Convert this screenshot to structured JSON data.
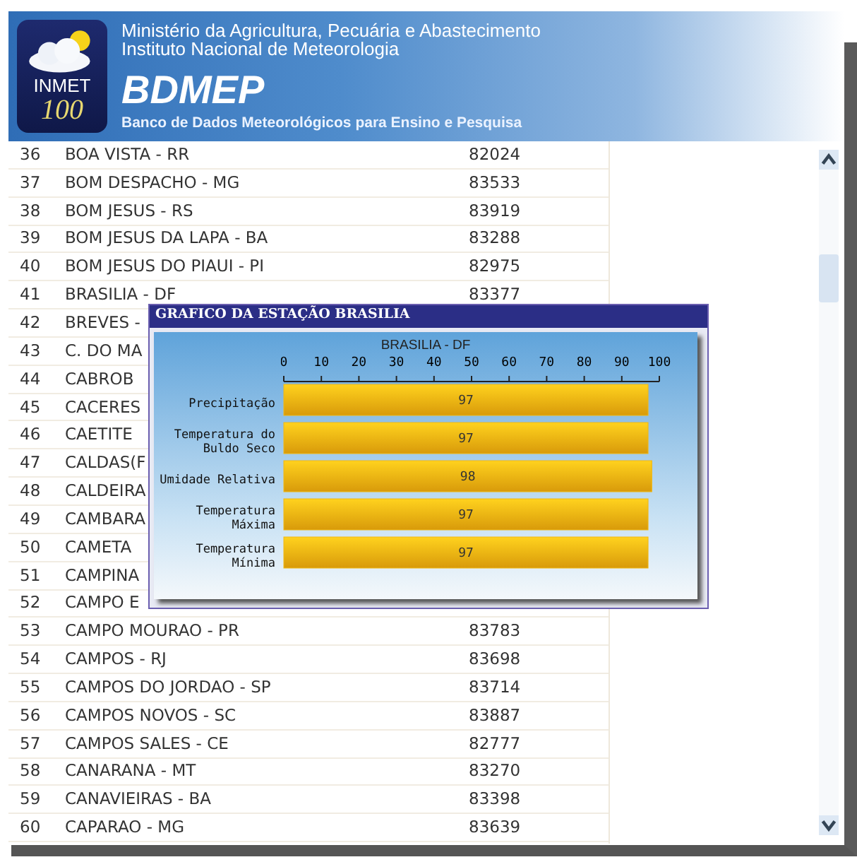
{
  "header": {
    "logo": {
      "line_1": "INMET",
      "line_2": "100"
    },
    "ministry": "Ministério da Agricultura, Pecuária e Abastecimento",
    "institute": "Instituto Nacional de Meteorologia",
    "title": "BDMEP",
    "subtitle": "Banco de Dados Meteorológicos para Ensino e Pesquisa"
  },
  "stations": [
    {
      "number": "36",
      "name": "BOA VISTA - RR",
      "code": "82024"
    },
    {
      "number": "37",
      "name": "BOM DESPACHO - MG",
      "code": "83533"
    },
    {
      "number": "38",
      "name": "BOM JESUS - RS",
      "code": "83919"
    },
    {
      "number": "39",
      "name": "BOM JESUS DA LAPA - BA",
      "code": "83288"
    },
    {
      "number": "40",
      "name": "BOM JESUS DO PIAUI - PI",
      "code": "82975"
    },
    {
      "number": "41",
      "name": "BRASILIA - DF",
      "code": "83377"
    },
    {
      "number": "42",
      "name": "BREVES -"
    },
    {
      "number": "43",
      "name": "C. DO MA"
    },
    {
      "number": "44",
      "name": "CABROB"
    },
    {
      "number": "45",
      "name": "CACERES"
    },
    {
      "number": "46",
      "name": "CAETITE"
    },
    {
      "number": "47",
      "name": "CALDAS(F"
    },
    {
      "number": "48",
      "name": "CALDEIRA"
    },
    {
      "number": "49",
      "name": "CAMBARA"
    },
    {
      "number": "50",
      "name": "CAMETA"
    },
    {
      "number": "51",
      "name": "CAMPINA"
    },
    {
      "number": "52",
      "name": "CAMPO E"
    },
    {
      "number": "53",
      "name": "CAMPO MOURAO - PR",
      "code": "83783"
    },
    {
      "number": "54",
      "name": "CAMPOS - RJ",
      "code": "83698"
    },
    {
      "number": "55",
      "name": "CAMPOS DO JORDAO - SP",
      "code": "83714"
    },
    {
      "number": "56",
      "name": "CAMPOS NOVOS - SC",
      "code": "83887"
    },
    {
      "number": "57",
      "name": "CAMPOS SALES - CE",
      "code": "82777"
    },
    {
      "number": "58",
      "name": "CANARANA - MT",
      "code": "83270"
    },
    {
      "number": "59",
      "name": "CANAVIEIRAS - BA",
      "code": "83398"
    },
    {
      "number": "60",
      "name": "CAPARAO - MG",
      "code": "83639"
    }
  ],
  "chart_window": {
    "title": "GRAFICO DA ESTAÇÃO BRASILIA",
    "chart_data": {
      "type": "bar",
      "orientation": "horizontal",
      "title": "BRASILIA - DF",
      "categories": [
        "Precipitação",
        "Temperatura do Buldo Seco",
        "Umidade Relativa",
        "Temperatura Máxima",
        "Temperatura Mínima"
      ],
      "series": [
        {
          "color": "#f0b814",
          "values": [
            97,
            97,
            98,
            97,
            97
          ]
        }
      ],
      "xlim": [
        0,
        100
      ],
      "xticks": [
        0,
        10,
        20,
        30,
        40,
        50,
        60,
        70,
        80,
        90,
        100
      ],
      "data_labels": true
    }
  }
}
